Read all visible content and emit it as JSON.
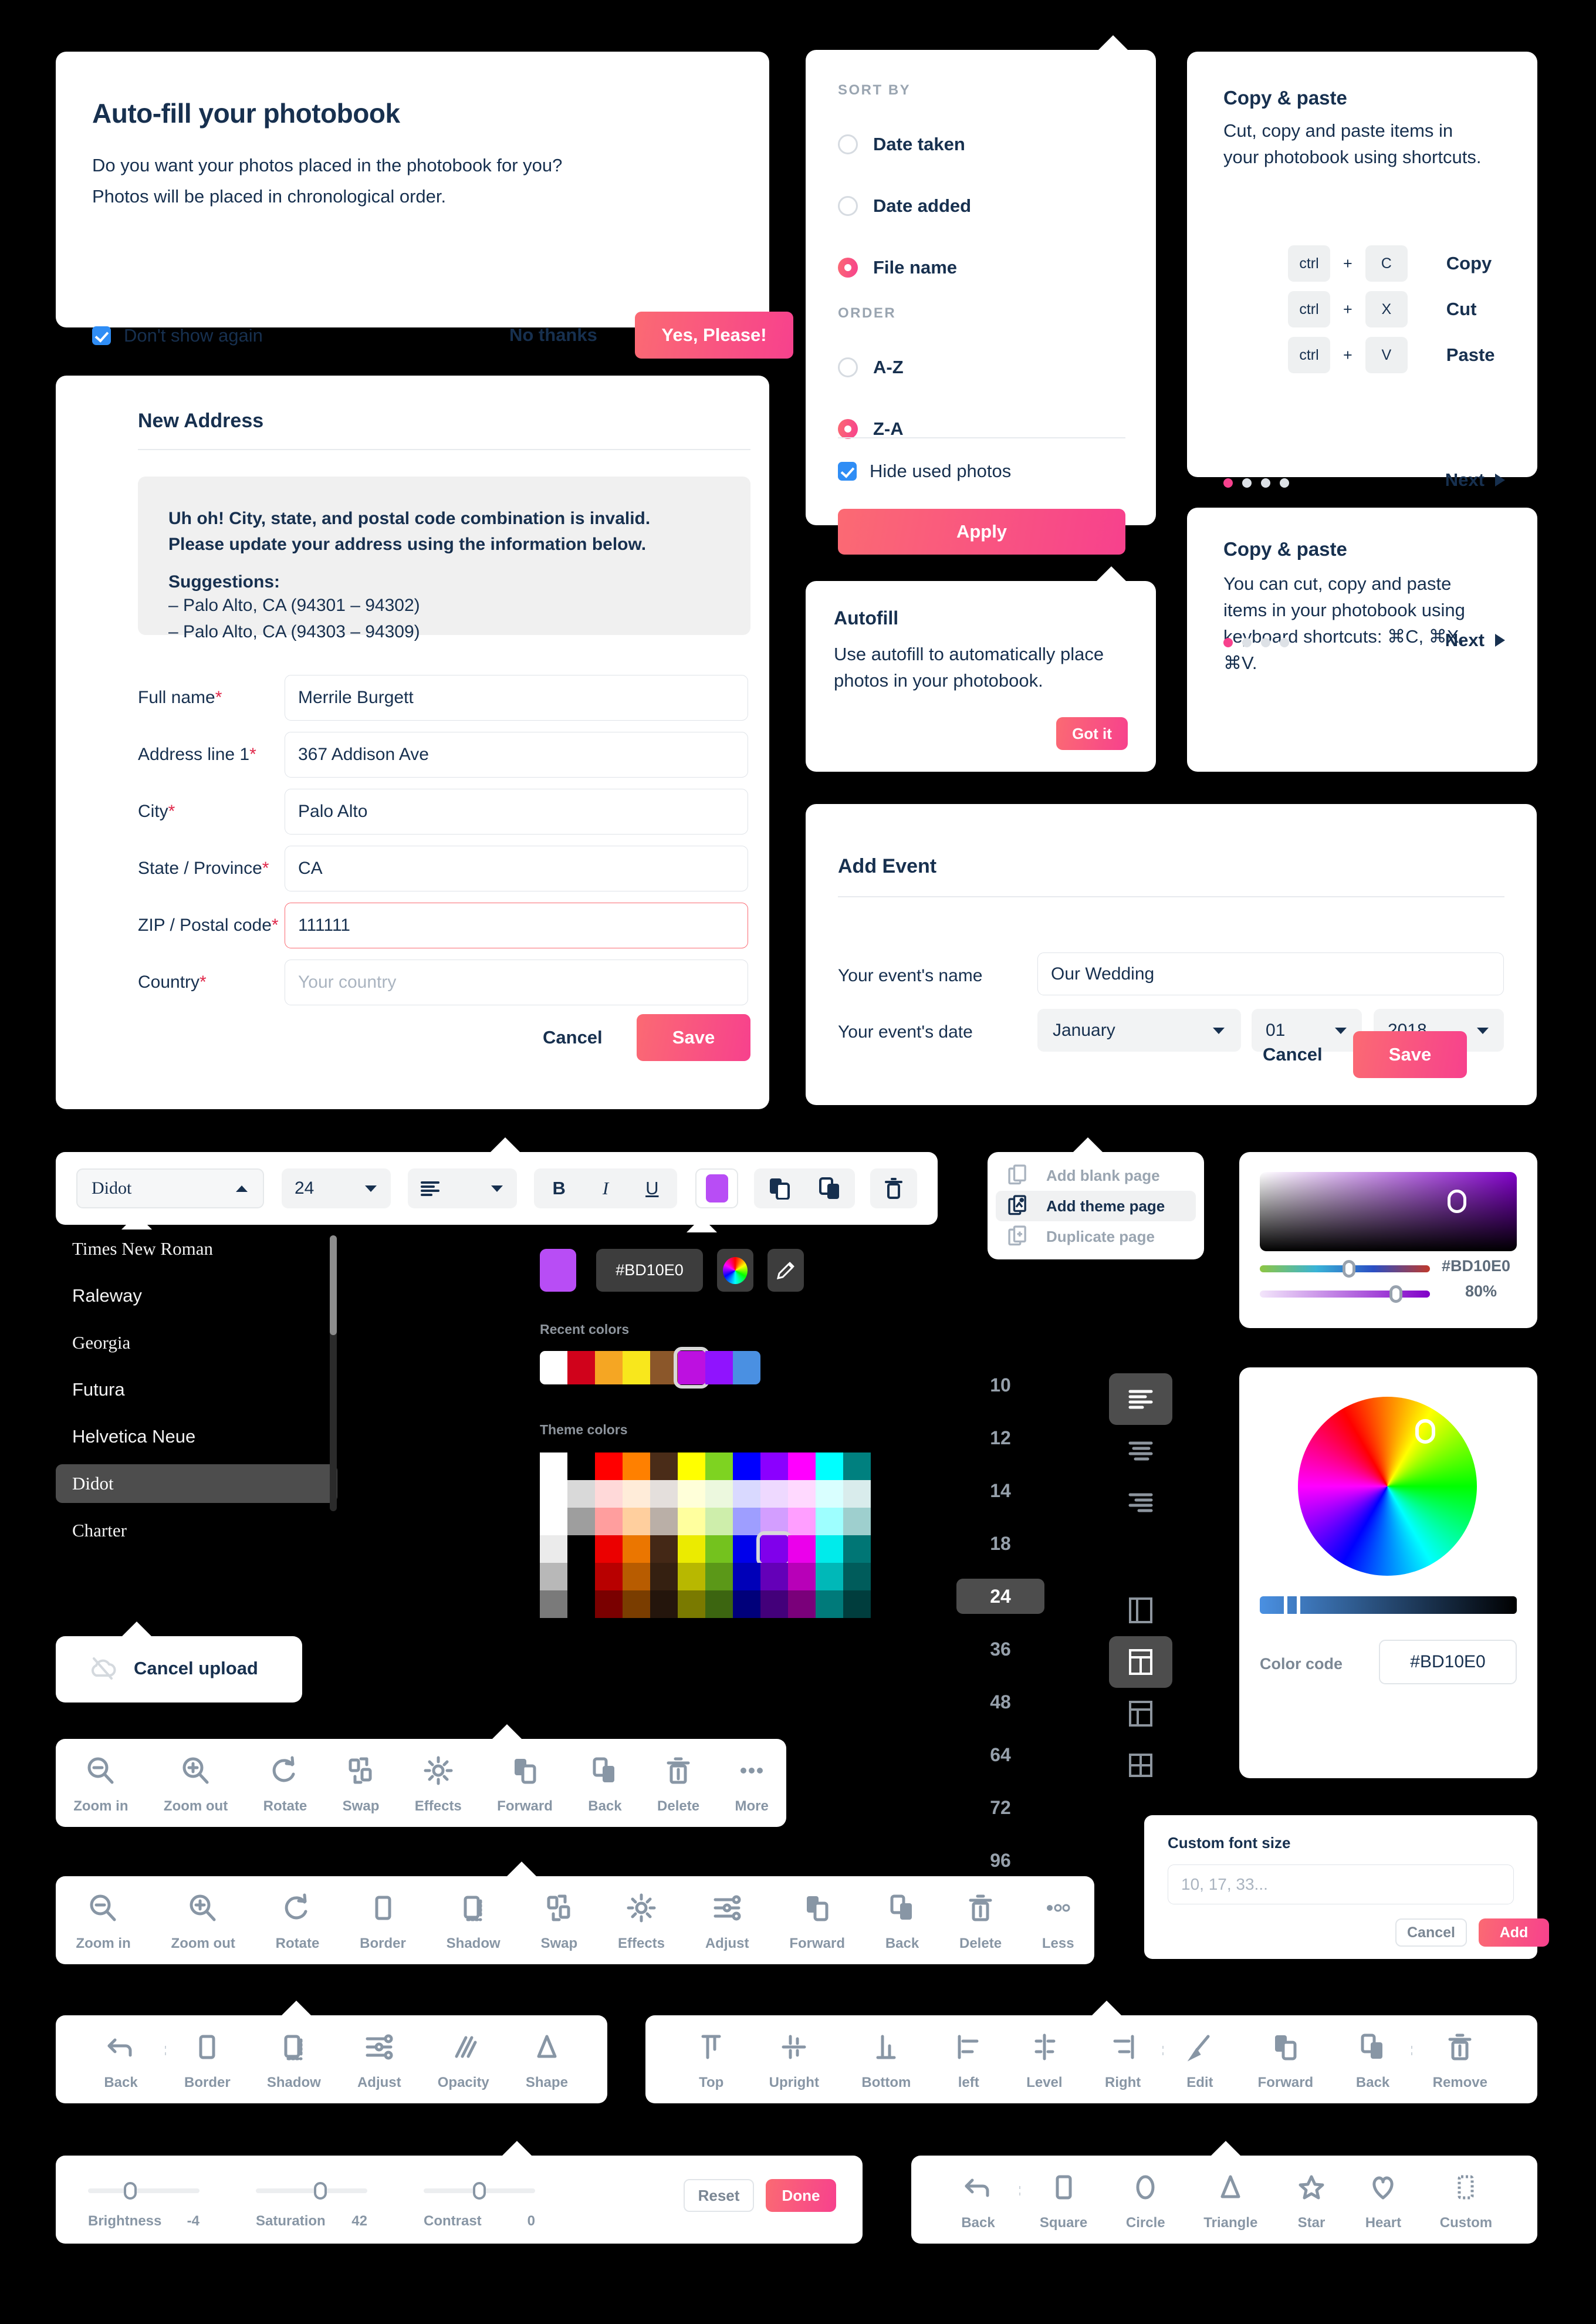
{
  "autofill_modal": {
    "title": "Auto-fill your photobook",
    "body_line1": "Do you want your photos placed in the photobook for you?",
    "body_line2": "Photos will be placed in chronological order.",
    "dont_show_label": "Don't show again",
    "no_thanks": "No thanks",
    "yes_please": "Yes, Please!"
  },
  "new_address": {
    "title": "New Address",
    "error_line1": "Uh oh! City, state, and postal code combination is invalid.",
    "error_line2": "Please update your address using the information below.",
    "suggestions_label": "Suggestions:",
    "suggestions": [
      "– Palo Alto, CA (94301 – 94302)",
      "– Palo Alto, CA (94303 – 94309)"
    ],
    "fields": [
      {
        "label": "Full name",
        "required": "*",
        "value": "Merrile Burgett",
        "placeholder": "",
        "invalid": false
      },
      {
        "label": "Address line 1",
        "required": "*",
        "value": "367 Addison Ave",
        "placeholder": "",
        "invalid": false
      },
      {
        "label": "City",
        "required": "*",
        "value": "Palo Alto",
        "placeholder": "",
        "invalid": false
      },
      {
        "label": "State / Province",
        "required": "*",
        "value": "CA",
        "placeholder": "",
        "invalid": false
      },
      {
        "label": "ZIP / Postal code",
        "required": "*",
        "value": "111111",
        "placeholder": "",
        "invalid": true
      },
      {
        "label": "Country",
        "required": "*",
        "value": "",
        "placeholder": "Your country",
        "invalid": false
      }
    ],
    "cancel": "Cancel",
    "save": "Save"
  },
  "sort_panel": {
    "sort_by_label": "SORT BY",
    "sort_options": [
      {
        "label": "Date taken",
        "selected": false
      },
      {
        "label": "Date added",
        "selected": false
      },
      {
        "label": "File name",
        "selected": true
      }
    ],
    "order_label": "ORDER",
    "order_options": [
      {
        "label": "A-Z",
        "selected": false
      },
      {
        "label": "Z-A",
        "selected": true
      }
    ],
    "hide_used_label": "Hide used photos",
    "hide_used_checked": true,
    "apply": "Apply"
  },
  "copy_paste_card": {
    "title": "Copy & paste",
    "body": "Cut, copy and paste items in your photobook using shortcuts.",
    "shortcuts": [
      {
        "mod": "ctrl",
        "plus": "+",
        "key": "C",
        "action": "Copy"
      },
      {
        "mod": "ctrl",
        "plus": "+",
        "key": "X",
        "action": "Cut"
      },
      {
        "mod": "ctrl",
        "plus": "+",
        "key": "V",
        "action": "Paste"
      }
    ],
    "dots_total": 4,
    "dots_active": 1,
    "next": "Next"
  },
  "copy_paste_card2": {
    "title": "Copy & paste",
    "body": "You can cut, copy and paste items in your photobook using keyboard shortcuts: ⌘C, ⌘X, ⌘V.",
    "dots_total": 4,
    "dots_active": 1,
    "next": "Next"
  },
  "autofill_tooltip": {
    "title": "Autofill",
    "body": "Use autofill to automatically place photos in your photobook.",
    "got_it": "Got it"
  },
  "add_event": {
    "title": "Add Event",
    "name_label": "Your event's name",
    "name_value": "Our Wedding",
    "date_label": "Your event's date",
    "month": "January",
    "day": "01",
    "year": "2018",
    "cancel": "Cancel",
    "save": "Save"
  },
  "text_toolbar": {
    "font_value": "Didot",
    "size_value": "24",
    "bold": "B",
    "italic": "I",
    "underline": "U",
    "color_value": "#BD10E0"
  },
  "font_list": {
    "items": [
      "Times New Roman",
      "Raleway",
      "Georgia",
      "Futura",
      "Helvetica Neue",
      "Didot",
      "Charter"
    ],
    "selected": "Didot"
  },
  "color_popover": {
    "hex_value": "#BD10E0",
    "recent_label": "Recent colors",
    "recent_colors": [
      "#FFFFFF",
      "#D0021B",
      "#F5A623",
      "#F8E71C",
      "#8B572A",
      "#BD10E0",
      "#9013FE",
      "#4A90E2"
    ],
    "recent_selected_index": 5,
    "theme_label": "Theme colors",
    "theme_columns": [
      "#FFFFFF",
      "#000000",
      "#FF0000",
      "#FF8000",
      "#4A2C18",
      "#FFFF00",
      "#7ED321",
      "#0000FF",
      "#8B00FF",
      "#FF00FF",
      "#00FFFF",
      "#00807F"
    ],
    "theme_rows": 6,
    "theme_selected_row": 3,
    "theme_selected_col": 8
  },
  "page_menu": {
    "items": [
      {
        "label": "Add blank page",
        "selected": false,
        "icon": "blank-page-icon"
      },
      {
        "label": "Add theme page",
        "selected": true,
        "icon": "theme-page-icon"
      },
      {
        "label": "Duplicate page",
        "selected": false,
        "icon": "duplicate-page-icon"
      }
    ]
  },
  "gradient_picker": {
    "hex_value": "#BD10E0",
    "opacity_value": "80%"
  },
  "wheel_picker": {
    "color_code_label": "Color code",
    "color_code_value": "#BD10E0"
  },
  "font_size_list": {
    "sizes": [
      "10",
      "12",
      "14",
      "18",
      "24",
      "36",
      "48",
      "64",
      "72",
      "96"
    ],
    "selected": "24"
  },
  "align_buttons": [
    {
      "name": "align-left",
      "selected": true
    },
    {
      "name": "align-center",
      "selected": false
    },
    {
      "name": "align-right",
      "selected": false
    }
  ],
  "layout_buttons": [
    {
      "name": "layout-one-column",
      "selected": false
    },
    {
      "name": "layout-two-column",
      "selected": true
    },
    {
      "name": "layout-three-column",
      "selected": false
    },
    {
      "name": "layout-grid",
      "selected": false
    }
  ],
  "custom_font_size": {
    "title": "Custom font size",
    "placeholder": "10, 17, 33...",
    "value": "",
    "cancel": "Cancel",
    "add": "Add"
  },
  "cancel_upload": {
    "label": "Cancel upload"
  },
  "toolbar_short": {
    "items": [
      {
        "label": "Zoom in",
        "icon": "zoom-in-icon"
      },
      {
        "label": "Zoom out",
        "icon": "zoom-out-icon"
      },
      {
        "label": "Rotate",
        "icon": "rotate-icon"
      },
      {
        "label": "Swap",
        "icon": "swap-icon"
      },
      {
        "label": "Effects",
        "icon": "effects-icon"
      },
      {
        "label": "Forward",
        "icon": "forward-icon"
      },
      {
        "label": "Back",
        "icon": "back-layer-icon"
      },
      {
        "label": "Delete",
        "icon": "trash-icon"
      },
      {
        "label": "More",
        "icon": "more-icon"
      }
    ]
  },
  "toolbar_long": {
    "items": [
      {
        "label": "Zoom in",
        "icon": "zoom-in-icon"
      },
      {
        "label": "Zoom out",
        "icon": "zoom-out-icon"
      },
      {
        "label": "Rotate",
        "icon": "rotate-icon"
      },
      {
        "label": "Border",
        "icon": "border-icon"
      },
      {
        "label": "Shadow",
        "icon": "shadow-icon"
      },
      {
        "label": "Swap",
        "icon": "swap-icon"
      },
      {
        "label": "Effects",
        "icon": "effects-icon"
      },
      {
        "label": "Adjust",
        "icon": "adjust-icon"
      },
      {
        "label": "Forward",
        "icon": "forward-icon"
      },
      {
        "label": "Back",
        "icon": "back-layer-icon"
      },
      {
        "label": "Delete",
        "icon": "trash-icon"
      },
      {
        "label": "Less",
        "icon": "less-icon"
      }
    ]
  },
  "toolbar_style": {
    "back": {
      "label": "Back",
      "icon": "back-arrow-icon"
    },
    "items": [
      {
        "label": "Border",
        "icon": "border-icon"
      },
      {
        "label": "Shadow",
        "icon": "shadow-icon"
      },
      {
        "label": "Adjust",
        "icon": "adjust-icon"
      },
      {
        "label": "Opacity",
        "icon": "opacity-icon"
      },
      {
        "label": "Shape",
        "icon": "shape-icon"
      }
    ]
  },
  "toolbar_align": {
    "group1": [
      {
        "label": "Top",
        "icon": "align-top-icon"
      },
      {
        "label": "Upright",
        "icon": "align-middle-icon"
      },
      {
        "label": "Bottom",
        "icon": "align-bottom-icon"
      },
      {
        "label": "left",
        "icon": "align-left-icon"
      },
      {
        "label": "Level",
        "icon": "align-center-h-icon"
      },
      {
        "label": "Right",
        "icon": "align-right-icon"
      }
    ],
    "group2": [
      {
        "label": "Edit",
        "icon": "brush-icon"
      },
      {
        "label": "Forward",
        "icon": "forward-icon"
      },
      {
        "label": "Back",
        "icon": "back-layer-icon"
      }
    ],
    "group3": [
      {
        "label": "Remove",
        "icon": "trash-icon"
      }
    ]
  },
  "adjust_panel": {
    "sliders": [
      {
        "label": "Brightness",
        "value": "-4",
        "pos": 38
      },
      {
        "label": "Saturation",
        "value": "42",
        "pos": 58
      },
      {
        "label": "Contrast",
        "value": "0",
        "pos": 50
      }
    ],
    "reset": "Reset",
    "done": "Done"
  },
  "toolbar_shapes": {
    "back": {
      "label": "Back",
      "icon": "back-arrow-icon"
    },
    "items": [
      {
        "label": "Square",
        "icon": "square-icon"
      },
      {
        "label": "Circle",
        "icon": "circle-icon"
      },
      {
        "label": "Triangle",
        "icon": "triangle-icon"
      },
      {
        "label": "Star",
        "icon": "star-icon"
      },
      {
        "label": "Heart",
        "icon": "heart-icon"
      },
      {
        "label": "Custom",
        "icon": "custom-shape-icon"
      }
    ]
  },
  "colors": {
    "accent_pink": "#F7418D",
    "accent_coral": "#FB6A73",
    "ink": "#17304F",
    "purple": "#BD10E0"
  }
}
